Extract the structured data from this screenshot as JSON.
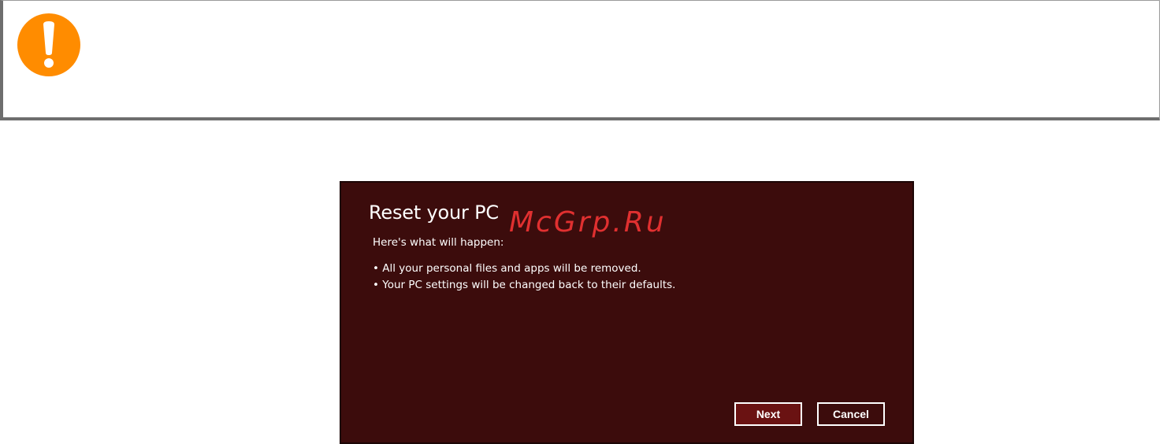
{
  "colors": {
    "warning_icon": "#ff8c00",
    "dialog_background": "#3c0c0c",
    "primary_button": "#6a1212",
    "watermark": "#e03030"
  },
  "warning": {
    "icon": "exclamation-icon",
    "glyph": "!"
  },
  "dialog": {
    "title": "Reset your PC",
    "watermark": "McGrp.Ru",
    "intro": "Here's what will happen:",
    "bullets": [
      "All your personal files and apps will be removed.",
      "Your PC settings will be changed back to their defaults."
    ],
    "buttons": {
      "next": "Next",
      "cancel": "Cancel"
    }
  }
}
